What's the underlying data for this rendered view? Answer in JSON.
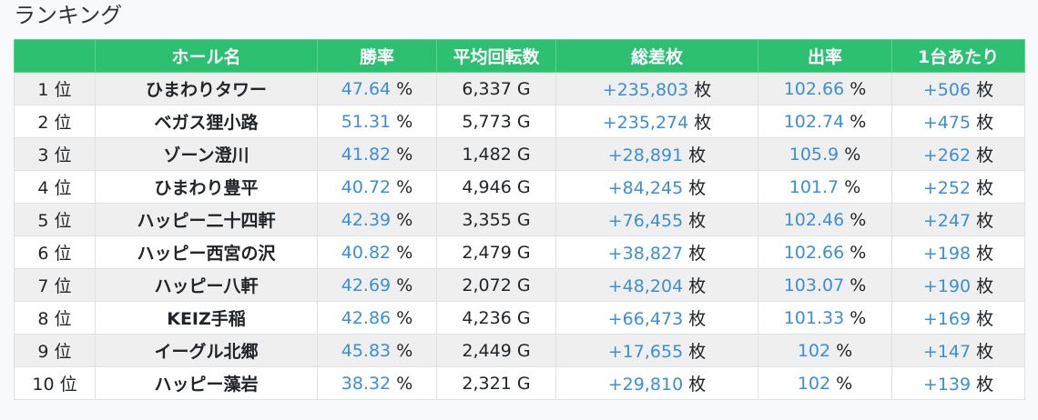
{
  "page": {
    "title": "ランキング"
  },
  "table": {
    "headers": [
      "",
      "ホール名",
      "勝率",
      "平均回転数",
      "総差枚",
      "出率",
      "1台あたり"
    ],
    "rows": [
      {
        "rank": "1 位",
        "hall": "ひまわりタワー",
        "win_rate": "47.64",
        "avg_spins": "6,337 G",
        "total_diff": "+235,803",
        "payout": "102.66",
        "per_machine": "+506"
      },
      {
        "rank": "2 位",
        "hall": "ベガス狸小路",
        "win_rate": "51.31",
        "avg_spins": "5,773 G",
        "total_diff": "+235,274",
        "payout": "102.74",
        "per_machine": "+475"
      },
      {
        "rank": "3 位",
        "hall": "ゾーン澄川",
        "win_rate": "41.82",
        "avg_spins": "1,482 G",
        "total_diff": "+28,891",
        "payout": "105.9",
        "per_machine": "+262"
      },
      {
        "rank": "4 位",
        "hall": "ひまわり豊平",
        "win_rate": "40.72",
        "avg_spins": "4,946 G",
        "total_diff": "+84,245",
        "payout": "101.7",
        "per_machine": "+252"
      },
      {
        "rank": "5 位",
        "hall": "ハッピー二十四軒",
        "win_rate": "42.39",
        "avg_spins": "3,355 G",
        "total_diff": "+76,455",
        "payout": "102.46",
        "per_machine": "+247"
      },
      {
        "rank": "6 位",
        "hall": "ハッピー西宮の沢",
        "win_rate": "40.82",
        "avg_spins": "2,479 G",
        "total_diff": "+38,827",
        "payout": "102.66",
        "per_machine": "+198"
      },
      {
        "rank": "7 位",
        "hall": "ハッピー八軒",
        "win_rate": "42.69",
        "avg_spins": "2,072 G",
        "total_diff": "+48,204",
        "payout": "103.07",
        "per_machine": "+190"
      },
      {
        "rank": "8 位",
        "hall": "KEIZ手稲",
        "win_rate": "42.86",
        "avg_spins": "4,236 G",
        "total_diff": "+66,473",
        "payout": "101.33",
        "per_machine": "+169"
      },
      {
        "rank": "9 位",
        "hall": "イーグル北郷",
        "win_rate": "45.83",
        "avg_spins": "2,449 G",
        "total_diff": "+17,655",
        "payout": "102",
        "per_machine": "+147"
      },
      {
        "rank": "10 位",
        "hall": "ハッピー藻岩",
        "win_rate": "38.32",
        "avg_spins": "2,321 G",
        "total_diff": "+29,810",
        "payout": "102",
        "per_machine": "+139"
      }
    ],
    "units": {
      "percent": "%",
      "coins": "枚"
    }
  },
  "colors": {
    "header_bg": "#2dc071",
    "accent_number": "#3b8ed8"
  }
}
